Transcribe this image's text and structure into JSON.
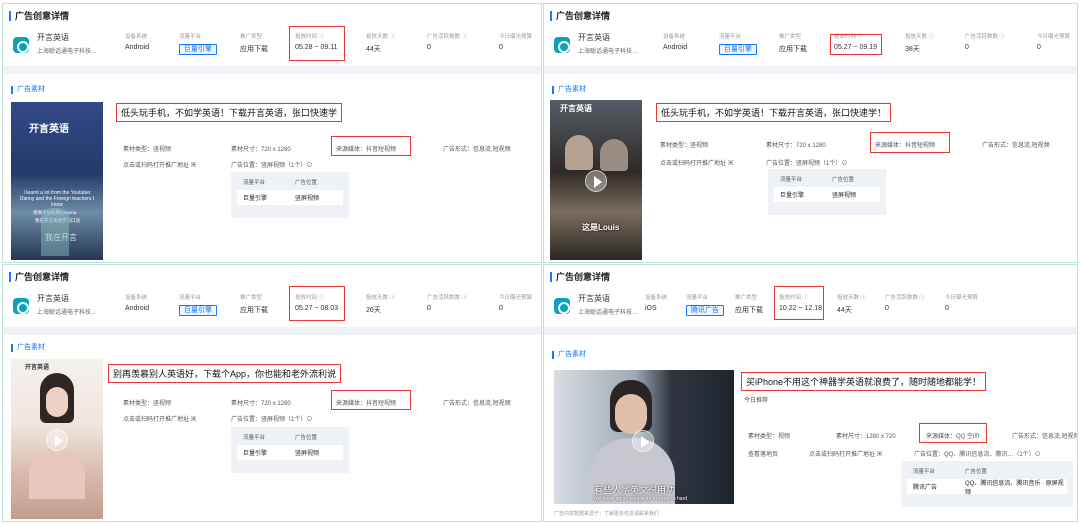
{
  "panels": [
    {
      "detail_title": "广告创意详情",
      "app_name": "开言英语",
      "company": "上海聪话通电子科技…",
      "labels": [
        "设备系统",
        "流量平台",
        "推广类型",
        "投放时间 ⓘ",
        "投放天数 ⓘ",
        "广告活跃数数 ⓘ",
        "今日曝光预算"
      ],
      "values": [
        "Android",
        "巨量引擎",
        "应用下载",
        "05.28 ~ 09.11",
        "44天",
        "0",
        "0"
      ],
      "material_title": "广告素材",
      "headline": "低头玩手机，不如学英语！下载开言英语，张口快速学",
      "meta": [
        "素材类型：竖视频",
        "素材尺寸：720 x 1280",
        "来源媒体：抖音短视频",
        "广告形式：信息流,短视频",
        "点击或扫码打开推广地址 ▣",
        "广告位置：竖屏视频（1个）⊙"
      ],
      "table_headers": [
        "流量平台",
        "广告位置"
      ],
      "table_cells": [
        "巨量引擎",
        "竖屏视频"
      ],
      "video_text": [
        "开言英语",
        "I learnt a lot from the Youtuber Danny and the Foreign teachers I know",
        "感谢千分的用心Kama",
        "我在开言英语学习口语",
        "我在开言"
      ]
    },
    {
      "detail_title": "广告创意详情",
      "app_name": "开言英语",
      "company": "上海聪话通电子科技…",
      "labels": [
        "设备系统",
        "流量平台",
        "推广类型",
        "投放时间 ⓘ",
        "投放天数 ⓘ",
        "广告活跃数数 ⓘ",
        "今日曝光预算"
      ],
      "values": [
        "Android",
        "巨量引擎",
        "应用下载",
        "05.27 ~ 09.19",
        "38天",
        "0",
        "0"
      ],
      "material_title": "广告素材",
      "headline": "低头玩手机，不如学英语！下载开言英语，张口快速学！",
      "meta": [
        "素材类型：竖视频",
        "素材尺寸：720 x 1280",
        "来源媒体：抖音短视频",
        "广告形式：信息流,短视频",
        "点击或扫码打开推广地址 ▣",
        "广告位置：竖屏视频（1个）⊙"
      ],
      "table_headers": [
        "流量平台",
        "广告位置"
      ],
      "table_cells": [
        "巨量引擎",
        "竖屏视频"
      ],
      "video_text": [
        "开言英语",
        "这是Louis"
      ]
    },
    {
      "detail_title": "广告创意详情",
      "app_name": "开言英语",
      "company": "上海聪话通电子科技…",
      "labels": [
        "设备系统",
        "流量平台",
        "推广类型",
        "投放时间 ⓘ",
        "投放天数 ⓘ",
        "广告活跃数数 ⓘ",
        "今日曝光预算"
      ],
      "values": [
        "Android",
        "巨量引擎",
        "应用下载",
        "05.27 ~ 08.03",
        "26天",
        "0",
        "0"
      ],
      "material_title": "广告素材",
      "headline": "别再羡慕别人英语好，下载个App，你也能和老外流利说",
      "meta": [
        "素材类型：竖视频",
        "素材尺寸：720 x 1280",
        "来源媒体：抖音短视频",
        "广告形式：信息流,短视频",
        "点击或扫码打开推广地址 ▣",
        "广告位置：竖屏视频（1个）⊙"
      ],
      "table_headers": [
        "流量平台",
        "广告位置"
      ],
      "table_cells": [
        "巨量引擎",
        "竖屏视频"
      ],
      "video_text": [
        "开言英语"
      ]
    },
    {
      "detail_title": "广告创意详情",
      "app_name": "开言英语",
      "company": "上海聪话通电子科技…",
      "labels": [
        "设备系统",
        "流量平台",
        "推广类型",
        "投放时间 ⓘ",
        "投放天数 ⓘ",
        "广告活跃数数 ⓘ",
        "今日曝光预算"
      ],
      "values": [
        "iOS",
        "腾讯广告",
        "应用下载",
        "10.22 ~ 12.18",
        "44天",
        "0",
        "0"
      ],
      "material_title": "广告素材",
      "headline": "买iPhone不用这个神器学英语就浪费了，随时随地都能学！",
      "subline": "今日推荐",
      "meta": [
        "素材类型：视频",
        "素材尺寸：1280 x 720",
        "来源媒体：QQ 空间",
        "广告形式：信息流,短视频",
        "查看落地页",
        "点击或扫码打开推广地址 ▣",
        "广告位置：QQ、腾讯信息流、腾讯…（1个）⊙"
      ],
      "table_headers": [
        "流量平台",
        "广告位置"
      ],
      "table_cells": [
        "腾讯广告",
        "QQ、腾讯信息流、腾讯音乐 · 原屏视频"
      ],
      "video_text": [
        "有些人学英文很用功",
        "You know some people try to work so hard"
      ],
      "bottom": "广告内容数据来源于：了解更多信息请联系我们"
    }
  ]
}
